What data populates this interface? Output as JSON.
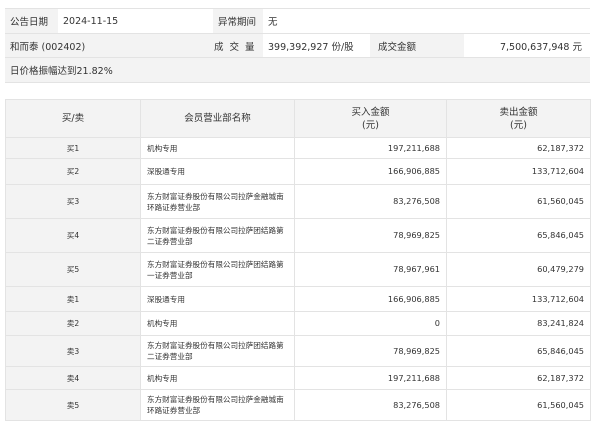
{
  "info": {
    "date_label": "公告日期",
    "date_value": "2024-11-15",
    "period_label": "异常期间",
    "period_value": "无",
    "stock_name": "和而泰 (002402)",
    "volume_label": "成 交 量",
    "volume_value": "399,392,927 份/股",
    "amount_label": "成交金额",
    "amount_value": "7,500,637,948 元",
    "reason": "日价格振幅达到21.82%"
  },
  "table": {
    "headers": {
      "direction": "买/卖",
      "dept": "会员营业部名称",
      "buy_line1": "买入金额",
      "buy_line2": "(元)",
      "sell_line1": "卖出金额",
      "sell_line2": "(元)"
    },
    "rows": [
      {
        "direction": "买1",
        "dept": "机构专用",
        "buy": "197,211,688",
        "sell": "62,187,372"
      },
      {
        "direction": "买2",
        "dept": "深股通专用",
        "buy": "166,906,885",
        "sell": "133,712,604"
      },
      {
        "direction": "买3",
        "dept": "东方财富证券股份有限公司拉萨金融城南环路证券营业部",
        "buy": "83,276,508",
        "sell": "61,560,045"
      },
      {
        "direction": "买4",
        "dept": "东方财富证券股份有限公司拉萨团结路第二证券营业部",
        "buy": "78,969,825",
        "sell": "65,846,045"
      },
      {
        "direction": "买5",
        "dept": "东方财富证券股份有限公司拉萨团结路第一证券营业部",
        "buy": "78,967,961",
        "sell": "60,479,279"
      },
      {
        "direction": "卖1",
        "dept": "深股通专用",
        "buy": "166,906,885",
        "sell": "133,712,604"
      },
      {
        "direction": "卖2",
        "dept": "机构专用",
        "buy": "0",
        "sell": "83,241,824"
      },
      {
        "direction": "卖3",
        "dept": "东方财富证券股份有限公司拉萨团结路第二证券营业部",
        "buy": "78,969,825",
        "sell": "65,846,045"
      },
      {
        "direction": "卖4",
        "dept": "机构专用",
        "buy": "197,211,688",
        "sell": "62,187,372"
      },
      {
        "direction": "卖5",
        "dept": "东方财富证券股份有限公司拉萨金融城南环路证券营业部",
        "buy": "83,276,508",
        "sell": "61,560,045"
      }
    ]
  },
  "colors": {
    "label_bg": "#f3f3f3",
    "border": "#e3e3e3",
    "text": "#333333"
  }
}
